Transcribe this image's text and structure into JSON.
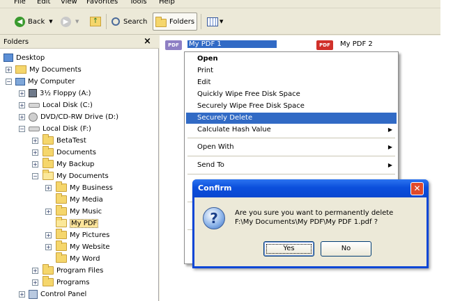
{
  "menubar": {
    "items": [
      "File",
      "Edit",
      "View",
      "Favorites",
      "Tools",
      "Help"
    ]
  },
  "toolbar": {
    "back_label": "Back",
    "search_label": "Search",
    "folders_label": "Folders"
  },
  "folders_pane": {
    "title": "Folders",
    "close_glyph": "×",
    "tree": [
      {
        "label": "Desktop"
      },
      {
        "label": "My Documents"
      },
      {
        "label": "My Computer"
      },
      {
        "label": "3½ Floppy (A:)"
      },
      {
        "label": "Local Disk (C:)"
      },
      {
        "label": "DVD/CD-RW Drive (D:)"
      },
      {
        "label": "Local Disk (F:)"
      },
      {
        "label": "BetaTest"
      },
      {
        "label": "Documents"
      },
      {
        "label": "My Backup"
      },
      {
        "label": "My Documents"
      },
      {
        "label": "My Business"
      },
      {
        "label": "My Media"
      },
      {
        "label": "My Music"
      },
      {
        "label": "My PDF"
      },
      {
        "label": "My Pictures"
      },
      {
        "label": "My Website"
      },
      {
        "label": "My Word"
      },
      {
        "label": "Program Files"
      },
      {
        "label": "Programs"
      },
      {
        "label": "Control Panel"
      }
    ]
  },
  "files": [
    {
      "name": "My PDF 1",
      "icon_text": "PDF",
      "color": "#8e7fc4"
    },
    {
      "name": "My PDF 2",
      "icon_text": "PDF",
      "color": "#d0302a"
    }
  ],
  "context_menu": {
    "items": [
      {
        "label": "Open"
      },
      {
        "label": "Print"
      },
      {
        "label": "Edit"
      },
      {
        "label": "Quickly Wipe Free Disk Space"
      },
      {
        "label": "Securely Wipe Free Disk Space"
      },
      {
        "label": "Securely Delete"
      },
      {
        "label": "Calculate Hash Value"
      },
      {
        "label": "Open With"
      },
      {
        "label": "Send To"
      }
    ],
    "submenu_arrow": "▶"
  },
  "dialog": {
    "title": "Confirm",
    "message_line1": "Are you sure you want to permanently delete",
    "message_line2": "F:\\My Documents\\My PDF\\My PDF 1.pdf ?",
    "yes_label": "Yes",
    "no_label": "No",
    "icon_glyph": "?",
    "close_glyph": "✕"
  },
  "colors": {
    "selection": "#316ac5",
    "titlebar": "#0a46d6",
    "window_bg": "#ece9d8"
  }
}
